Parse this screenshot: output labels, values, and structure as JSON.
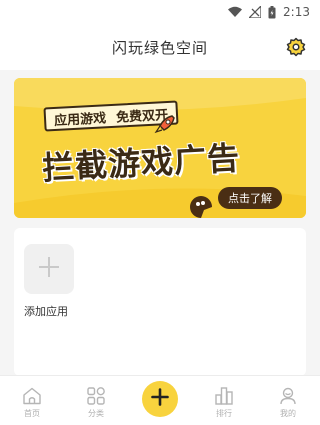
{
  "status_bar": {
    "time": "2:13"
  },
  "header": {
    "title": "闪玩绿色空间"
  },
  "banner": {
    "tagline_left": "应用游戏",
    "tagline_right": "免费双开",
    "headline": "拦截游戏广告",
    "cta": "点击了解"
  },
  "panel": {
    "add_label": "添加应用"
  },
  "tabs": [
    {
      "label": "首页"
    },
    {
      "label": "分类"
    },
    {
      "label": "排行"
    },
    {
      "label": "我的"
    }
  ],
  "colors": {
    "accent": "#f8d33e",
    "dark_brown": "#3b2a15",
    "cta_bg": "#4a2e14"
  }
}
